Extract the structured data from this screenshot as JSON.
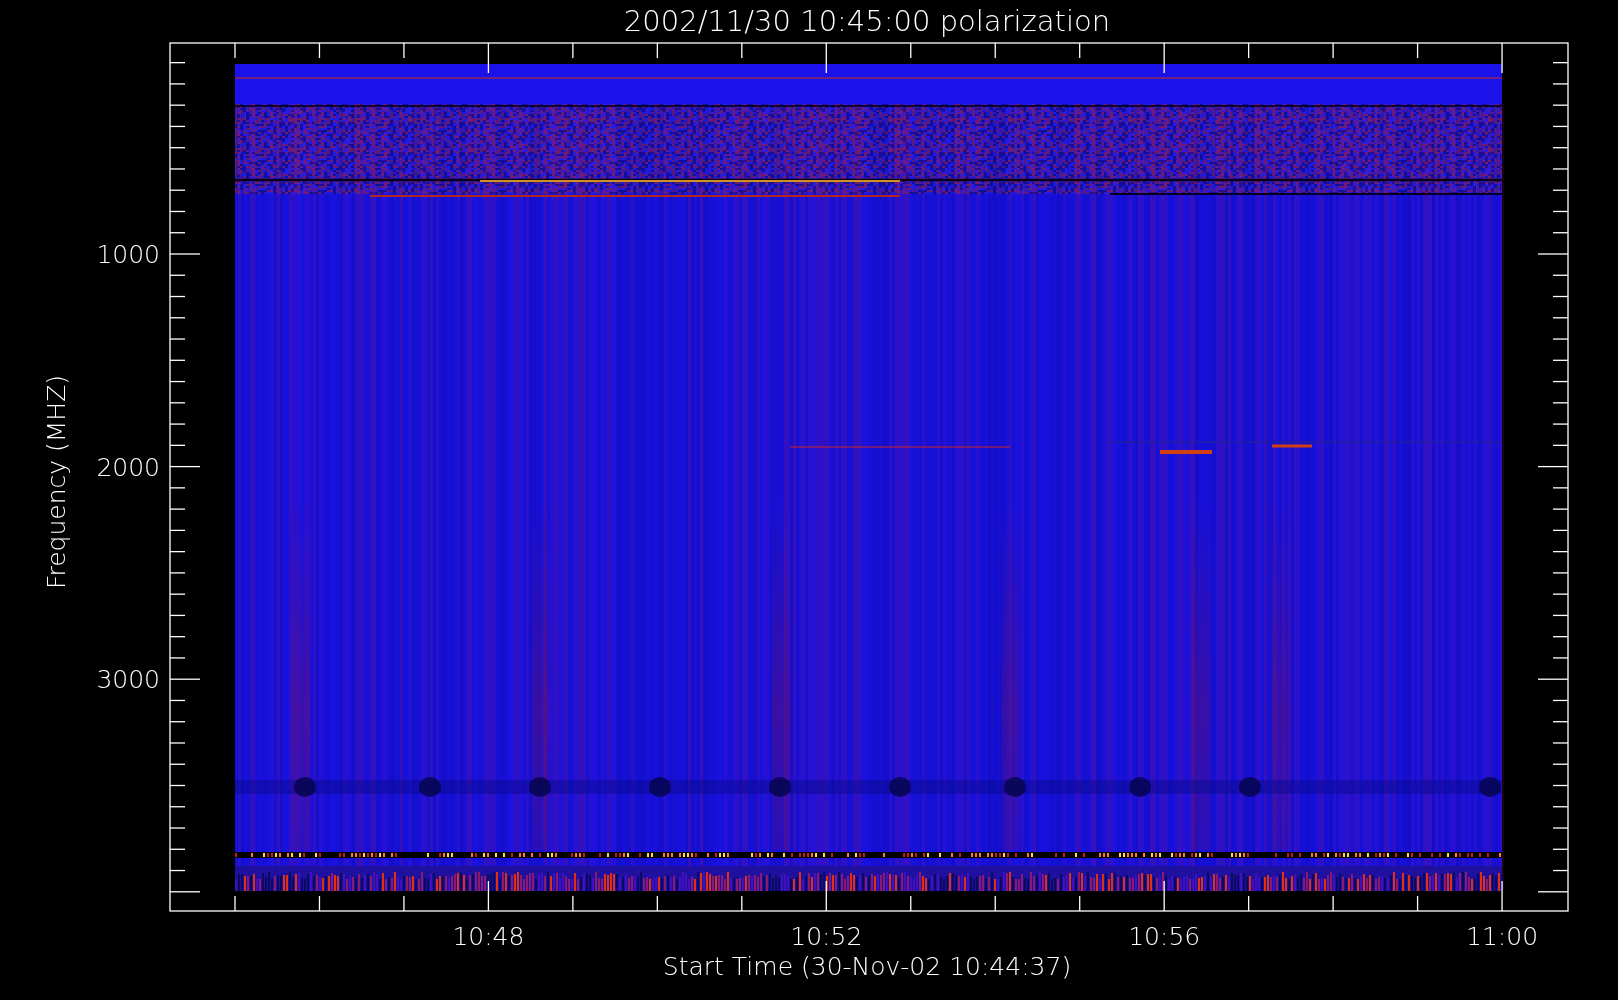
{
  "title": "2002/11/30 10:45:00 polarization",
  "y_axis": {
    "label": "Frequency (MHZ)",
    "tick_labels": [
      "1000",
      "2000",
      "3000"
    ]
  },
  "x_axis": {
    "label": "Start Time (30-Nov-02 10:44:37)",
    "tick_labels": [
      "10:48",
      "10:52",
      "10:56",
      "11:00"
    ]
  }
}
